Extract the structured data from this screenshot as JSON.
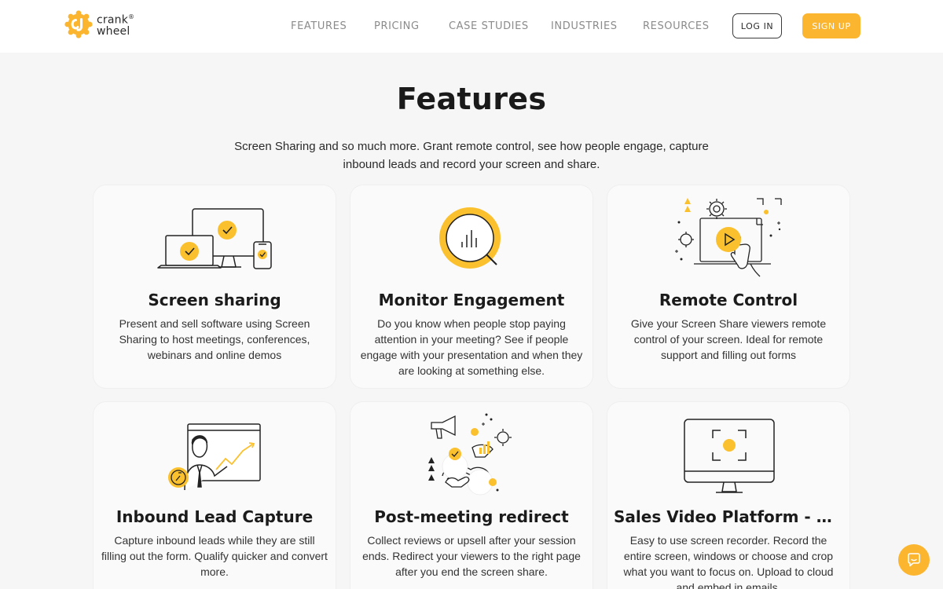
{
  "brand": {
    "logo_line1": "crank",
    "logo_line2": "wheel",
    "logo_mark": "®",
    "accent": "#fbb52e"
  },
  "nav": {
    "items": [
      {
        "label": "FEATURES"
      },
      {
        "label": "PRICING"
      },
      {
        "label": "CASE STUDIES"
      },
      {
        "label": "INDUSTRIES"
      },
      {
        "label": "RESOURCES"
      }
    ],
    "login_label": "LOG IN",
    "signup_label": "SIGN UP"
  },
  "hero": {
    "title": "Features",
    "subtitle": "Screen Sharing and so much more. Grant remote control, see how people engage, capture inbound leads and record your screen and share."
  },
  "cards": [
    {
      "title": "Screen sharing",
      "description": "Present and sell software using Screen Sharing to host meetings, conferences, webinars and online demos",
      "icon": "devices-icon"
    },
    {
      "title": "Monitor Engagement",
      "description": "Do you know when people stop paying attention in your meeting? See if people engage with your presentation and when they are looking at something else.",
      "icon": "magnifier-chart-icon"
    },
    {
      "title": "Remote Control",
      "description": "Give your Screen Share viewers remote control of your screen. Ideal for remote support and filling out forms",
      "icon": "remote-control-icon"
    },
    {
      "title": "Inbound Lead Capture",
      "description": "Capture inbound leads while they are still filling out the form. Qualify quicker and convert more.",
      "icon": "lead-capture-icon"
    },
    {
      "title": "Post-meeting redirect",
      "description": "Collect reviews or upsell after your session ends. Redirect your viewers to the right page after you end the screen share.",
      "icon": "redirect-icon"
    },
    {
      "title": "Sales Video Platform - Screen Recorder",
      "description": "Easy to use screen recorder. Record the entire screen, windows or choose and crop what you want to focus on. Upload to cloud and embed in emails.",
      "icon": "screen-recorder-icon"
    }
  ],
  "chat": {
    "icon": "chat-icon"
  }
}
